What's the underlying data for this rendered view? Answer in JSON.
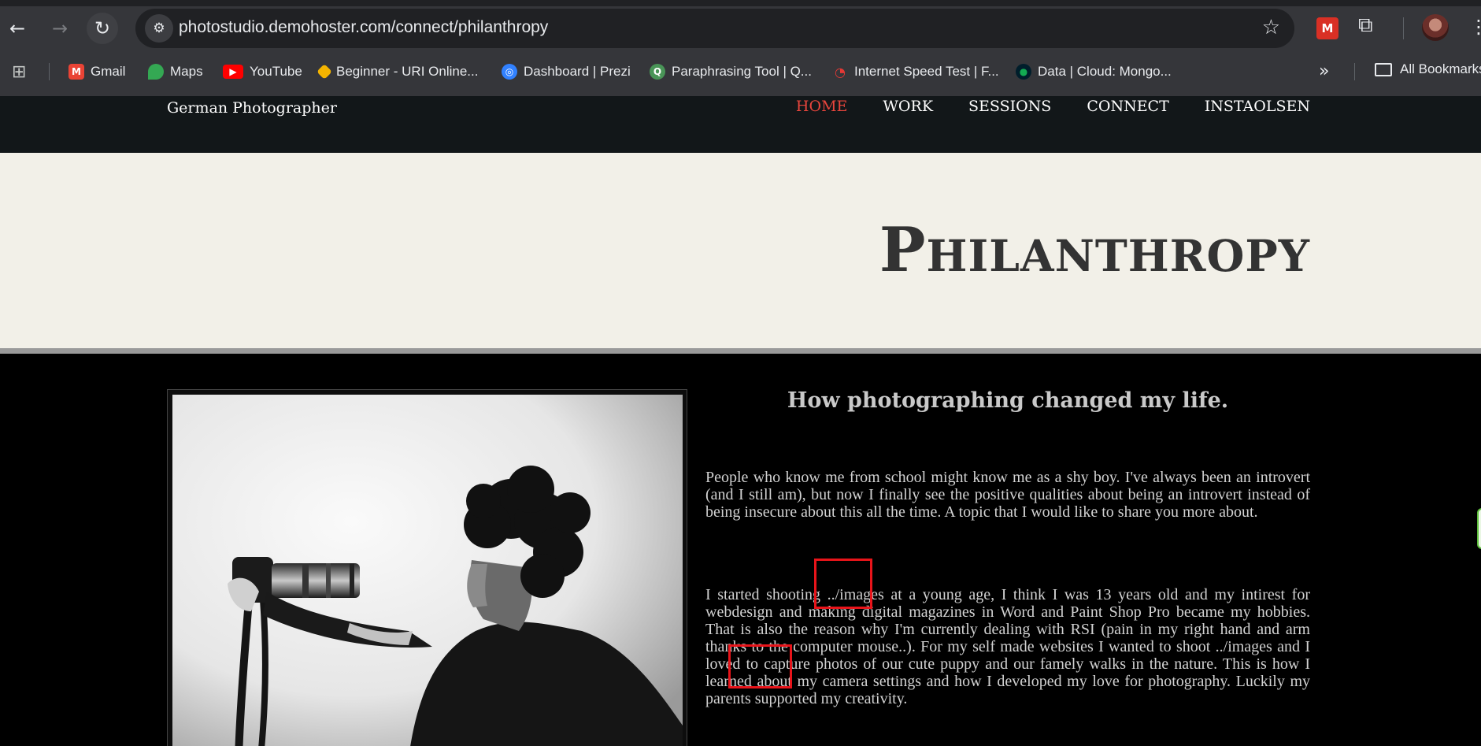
{
  "browser": {
    "url": "photostudio.demohoster.com/connect/philanthropy",
    "bookmarks": [
      {
        "label": "Gmail",
        "icon": "gmail-icon",
        "color": "#ea4335"
      },
      {
        "label": "Maps",
        "icon": "maps-icon",
        "color": "#34a853"
      },
      {
        "label": "YouTube",
        "icon": "youtube-icon",
        "color": "#ff0000"
      },
      {
        "label": "Beginner - URI Online...",
        "icon": "uri-icon",
        "color": "#f4b400"
      },
      {
        "label": "Dashboard | Prezi",
        "icon": "prezi-icon",
        "color": "#3181ff"
      },
      {
        "label": "Paraphrasing Tool | Q...",
        "icon": "quillbot-icon",
        "color": "#499557"
      },
      {
        "label": "Internet Speed Test | F...",
        "icon": "speedtest-icon",
        "color": "#e53935"
      },
      {
        "label": "Data | Cloud: Mongo...",
        "icon": "mongodb-icon",
        "color": "#13aa52"
      }
    ],
    "all_bookmarks": "All Bookmarks"
  },
  "site": {
    "brand": "German Photographer",
    "menu": [
      {
        "label": "HOME",
        "active": true
      },
      {
        "label": "WORK",
        "active": false
      },
      {
        "label": "SESSIONS",
        "active": false
      },
      {
        "label": "CONNECT",
        "active": false
      },
      {
        "label": "INSTAOLSEN",
        "active": false
      }
    ],
    "accent_color": "#e8453c",
    "page_title": "Philanthropy",
    "heading": "How photographing changed my life.",
    "paragraphs": [
      "People who know me from school might know me as a shy boy. I've always been an introvert (and I still am), but now I finally see the positive qualities about being an introvert instead of being insecure about this all the time. A topic that I would like to share you more about.",
      "I started shooting ../images at a young age, I think I was 13 years old and my intirest for webdesign and making digital magazines in Word and Paint Shop Pro became my hobbies. That is also the reason why I'm currently dealing with RSI (pain in my right hand and arm thanks to the computer mouse..). For my self made websites I wanted to shoot ../images and I loved to capture photos of our cute puppy and our famely walks in the nature. This is how I learned about my camera settings and how I developed my love for photography. Luckily my parents supported my creativity."
    ]
  }
}
